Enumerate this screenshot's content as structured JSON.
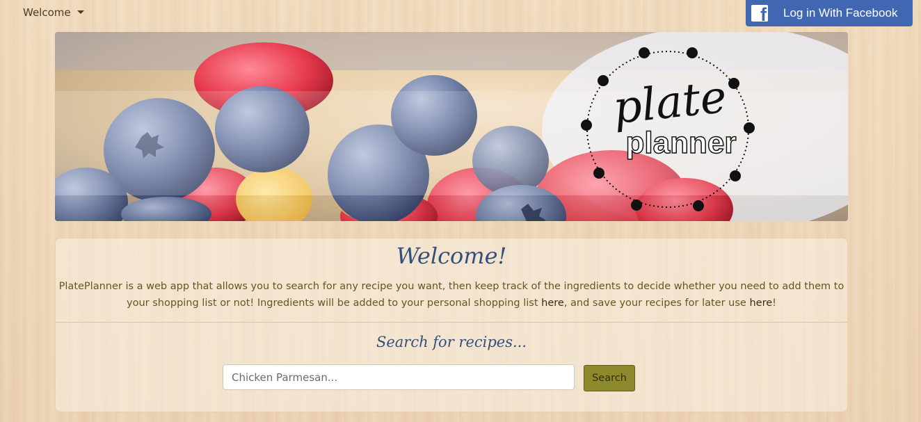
{
  "nav": {
    "welcome_label": "Welcome",
    "facebook_label": "Log in With Facebook"
  },
  "banner": {
    "logo_line1": "plate",
    "logo_line2": "planner"
  },
  "welcome_card": {
    "title": "Welcome!",
    "text_part1": "PlatePlanner is a web app that allows you to search for any recipe you want, then keep track of the ingredients to decide whether you need to add them to your shopping list or not! Ingredients will be added to your personal shopping list ",
    "link1": "here",
    "text_part2": ", and save your recipes for later use ",
    "link2": "here",
    "text_part3": "!"
  },
  "search": {
    "title": "Search for recipes...",
    "placeholder": "Chicken Parmesan...",
    "button_label": "Search"
  },
  "colors": {
    "facebook": "#4267b2",
    "search_button": "#8c8a2d",
    "heading": "#34507a"
  }
}
